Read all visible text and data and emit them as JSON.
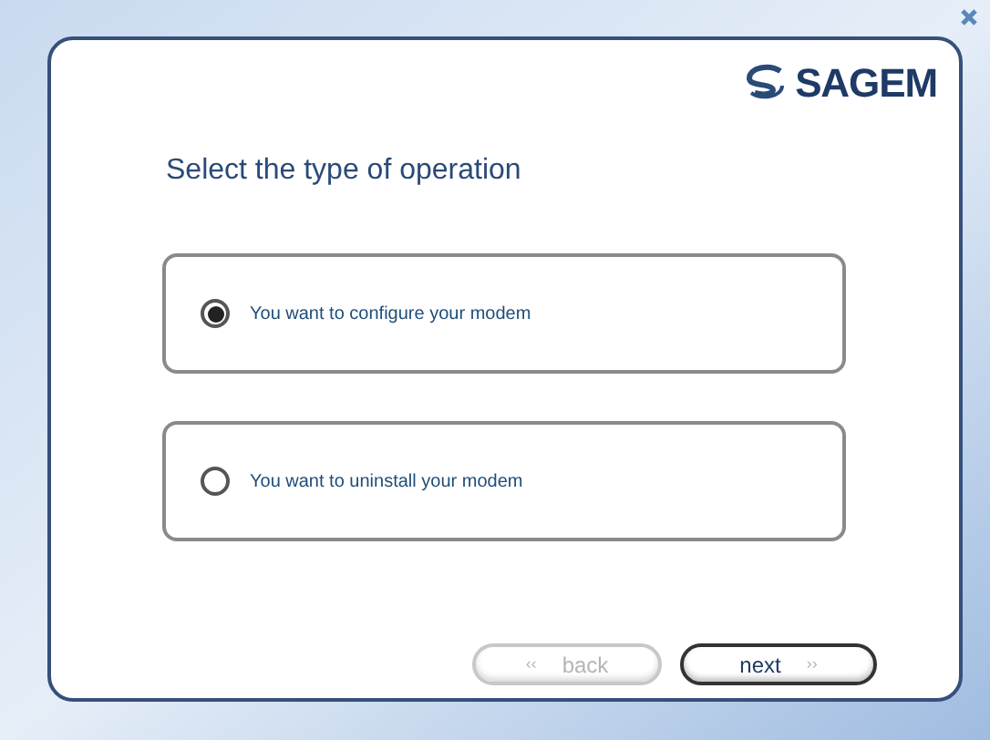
{
  "brand": "SAGEM",
  "heading": "Select the type of operation",
  "options": [
    {
      "label": "You want to configure your modem",
      "selected": true
    },
    {
      "label": "You want to uninstall your modem",
      "selected": false
    }
  ],
  "buttons": [
    {
      "label": "back",
      "leading_glyph": "‹‹",
      "disabled": true
    },
    {
      "label": "next",
      "trailing_glyph": "››",
      "disabled": false
    }
  ]
}
